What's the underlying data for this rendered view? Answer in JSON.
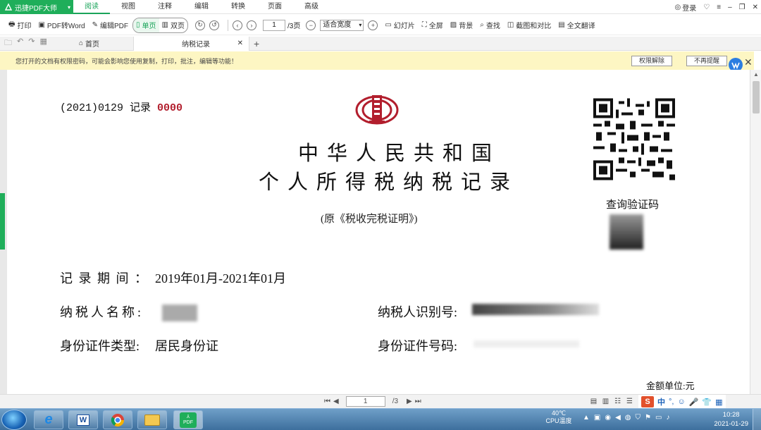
{
  "app": {
    "name": "迅捷PDF大师",
    "menu": [
      "阅读",
      "视图",
      "注释",
      "编辑",
      "转换",
      "页面",
      "高级"
    ],
    "active_menu": "阅读",
    "login": "登录"
  },
  "toolbar": {
    "print": "打印",
    "pdf_to_word": "PDF转Word",
    "edit_pdf": "编辑PDF",
    "single_page": "单页",
    "double_page": "双页",
    "page_current": "1",
    "page_total": "/3页",
    "zoom": "适合宽度",
    "slideshow": "幻灯片",
    "fullscreen": "全屏",
    "background": "背景",
    "find": "查找",
    "screenshot_compare": "截图和对比",
    "translate": "全文翻译"
  },
  "tabs": {
    "home": "首页",
    "document": "纳税记录"
  },
  "notice": {
    "text": "您打开的文档有权限密码，可能会影响您使用复制，打印，批注，编辑等功能！",
    "unlock": "权限解除",
    "dismiss": "不再提醒"
  },
  "document": {
    "record_no_prefix": "(2021)0129 记录",
    "record_no_red": "0000",
    "title_line1": "中华人民共和国",
    "title_line2": "个人所得税纳税记录",
    "subtitle": "(原《税收完税证明》)",
    "qr_label": "查询验证码",
    "period_label": "记 录 期 间 ：",
    "period_value": "2019年01月-2021年01月",
    "taxpayer_name_label": "纳税人名称:",
    "taxpayer_id_label": "纳税人识别号:",
    "id_type_label": "身份证件类型:",
    "id_type_value": "居民身份证",
    "id_number_label": "身份证件号码:",
    "unit": "金额单位:元"
  },
  "navbar": {
    "page_current": "1",
    "page_total": "/3"
  },
  "ime": {
    "lang": "中"
  },
  "taskbar": {
    "temp": "40℃",
    "cpu_label": "CPU温度",
    "time": "10:28",
    "date": "2021-01-29",
    "pdf_app_label": "PDF"
  },
  "colors": {
    "accent": "#1fae5a",
    "notice_bg": "#fdf6c3",
    "record_red": "#b21e2d"
  }
}
